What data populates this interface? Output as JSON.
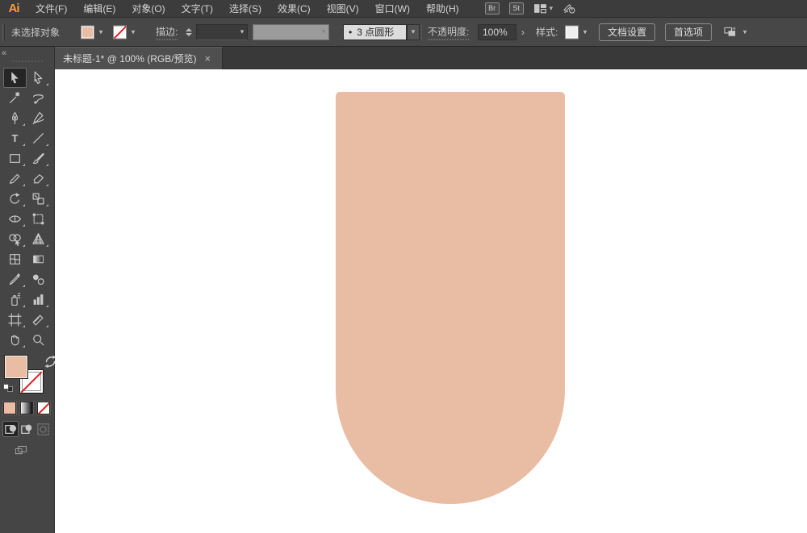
{
  "app": {
    "logo_text": "Ai"
  },
  "glyphs": {
    "chevron_down": "▾",
    "chevron_right": "›",
    "collapse": "«",
    "close": "×",
    "bullet": "•",
    "type_tool": "T"
  },
  "menubar": {
    "items": [
      "文件(F)",
      "编辑(E)",
      "对象(O)",
      "文字(T)",
      "选择(S)",
      "效果(C)",
      "视图(V)",
      "窗口(W)",
      "帮助(H)"
    ],
    "bridge_label": "Br",
    "stock_label": "St"
  },
  "optionsbar": {
    "status_label": "未选择对象",
    "stroke_label": "描边:",
    "brush_value": "3 点圆形",
    "opacity_label": "不透明度:",
    "opacity_value": "100%",
    "style_label": "样式:",
    "document_setup_label": "文档设置",
    "preferences_label": "首选项"
  },
  "tabbar": {
    "active_tab_title": "未标题-1* @ 100% (RGB/预览)"
  },
  "toolbar": {
    "tools": [
      "selection",
      "direct-selection",
      "magic-wand",
      "lasso",
      "pen",
      "curvature",
      "type",
      "line-segment",
      "rectangle",
      "paintbrush",
      "pencil",
      "eraser",
      "rotate",
      "scale",
      "width",
      "free-transform",
      "shape-builder",
      "perspective-grid",
      "mesh",
      "gradient",
      "eyedropper",
      "blend",
      "symbol-sprayer",
      "column-graph",
      "artboard",
      "slice",
      "hand",
      "zoom"
    ],
    "active_tool": "selection",
    "drawing_modes": [
      "draw-normal",
      "draw-behind",
      "draw-inside"
    ],
    "active_drawing_mode": "draw-normal"
  },
  "colors": {
    "fill_swatch": "#e9bca4",
    "stroke_none_red": "#d92121",
    "logo_orange": "#ff9a33",
    "ui_dark": "#454545",
    "canvas_bg": "#ffffff"
  },
  "canvas": {
    "zoom_percent": "100%",
    "shape": {
      "type": "rounded-bottom-rectangle",
      "fill": "#e9bca4"
    }
  }
}
